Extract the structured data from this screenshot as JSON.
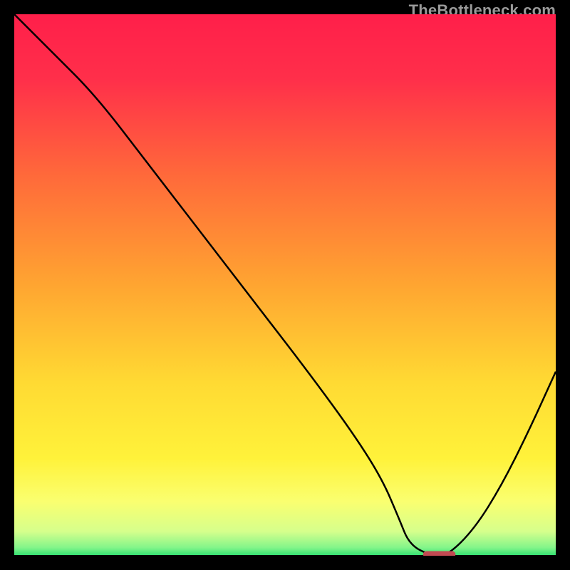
{
  "watermark": "TheBottleneck.com",
  "colors": {
    "frame": "#000000",
    "gradient_stops": [
      {
        "offset": 0.0,
        "color": "#ff1f4a"
      },
      {
        "offset": 0.12,
        "color": "#ff2f4a"
      },
      {
        "offset": 0.3,
        "color": "#ff6a3a"
      },
      {
        "offset": 0.5,
        "color": "#ffa531"
      },
      {
        "offset": 0.68,
        "color": "#ffda33"
      },
      {
        "offset": 0.82,
        "color": "#fff23a"
      },
      {
        "offset": 0.9,
        "color": "#faff70"
      },
      {
        "offset": 0.955,
        "color": "#d6ff8c"
      },
      {
        "offset": 0.985,
        "color": "#83f58a"
      },
      {
        "offset": 1.0,
        "color": "#2fe070"
      }
    ],
    "curve": "#000000",
    "marker": "#c24a52"
  },
  "chart_data": {
    "type": "line",
    "title": "",
    "xlabel": "",
    "ylabel": "",
    "xlim": [
      0,
      100
    ],
    "ylim": [
      0,
      100
    ],
    "grid": false,
    "legend": false,
    "series": [
      {
        "name": "bottleneck-curve",
        "x": [
          0,
          7,
          15,
          25,
          35,
          45,
          55,
          63,
          68,
          71,
          73,
          77,
          80,
          85,
          90,
          95,
          100
        ],
        "y": [
          100,
          93,
          85,
          72,
          59,
          46,
          33,
          22,
          14,
          7,
          2,
          0,
          0,
          5,
          13,
          23,
          34
        ]
      }
    ],
    "marker": {
      "x": 78.5,
      "y": 0,
      "width": 6,
      "height": 1.2
    },
    "baseline_y": 0
  }
}
